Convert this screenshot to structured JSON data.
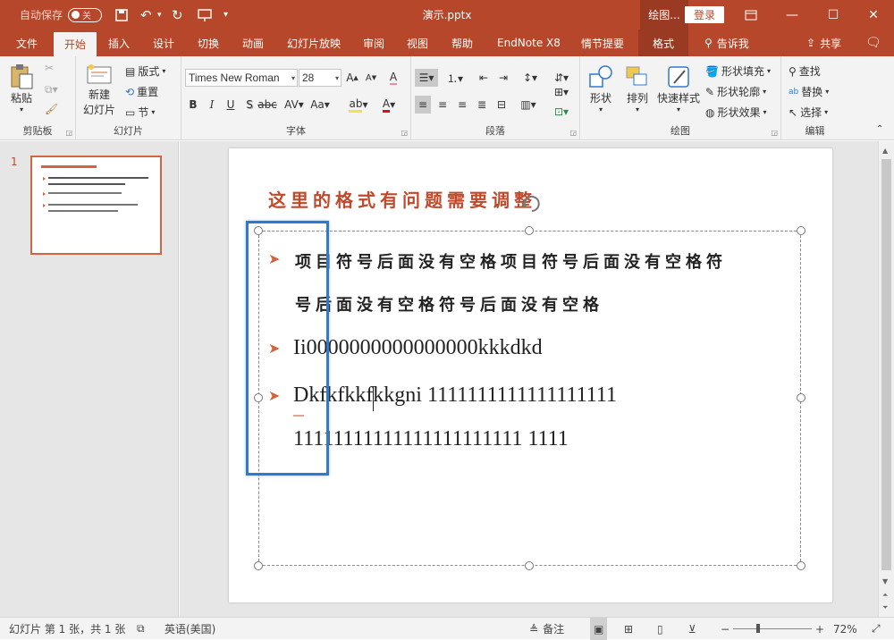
{
  "titlebar": {
    "autosave_label": "自动保存",
    "autosave_state": "关",
    "doc_title": "演示.pptx",
    "context_tools": "绘图...",
    "login": "登录"
  },
  "tabs": [
    "文件",
    "开始",
    "插入",
    "设计",
    "切换",
    "动画",
    "幻灯片放映",
    "审阅",
    "视图",
    "帮助",
    "EndNote X8",
    "情节提要",
    "格式"
  ],
  "tell_me": "告诉我",
  "share": "共享",
  "ribbon": {
    "clipboard": {
      "label": "剪贴板",
      "paste": "粘贴"
    },
    "slides": {
      "label": "幻灯片",
      "new_slide_1": "新建",
      "new_slide_2": "幻灯片",
      "layout": "版式",
      "reset": "重置",
      "section": "节"
    },
    "font": {
      "label": "字体",
      "family": "Times New Roman",
      "size": "28"
    },
    "paragraph": {
      "label": "段落"
    },
    "drawing": {
      "label": "绘图",
      "shapes": "形状",
      "arrange": "排列",
      "quick_styles": "快速样式",
      "fill": "形状填充",
      "outline": "形状轮廓",
      "effects": "形状效果"
    },
    "editing": {
      "label": "编辑",
      "find": "查找",
      "replace": "替换",
      "select": "选择"
    }
  },
  "thumbnail": {
    "number": "1"
  },
  "slide": {
    "title": "这里的格式有问题需要调整",
    "bullet1_line1": "项目符号后面没有空格项目符号后面没有空格符",
    "bullet1_line2": "号后面没有空格符号后面没有空格",
    "bullet2": "Ii0000000000000000kkkdkd",
    "bullet3_line1": "Dkfkfkkfkkgni 1111111111111111111",
    "bullet3_line2": "11111111111111111111111 1111"
  },
  "status": {
    "slide_info": "幻灯片 第 1 张，共 1 张",
    "language": "英语(美国)",
    "notes": "备注",
    "zoom": "72%"
  },
  "colors": {
    "accent": "#b7472a",
    "bullet": "#d2643f",
    "highlight_box": "#2e7ad1"
  }
}
